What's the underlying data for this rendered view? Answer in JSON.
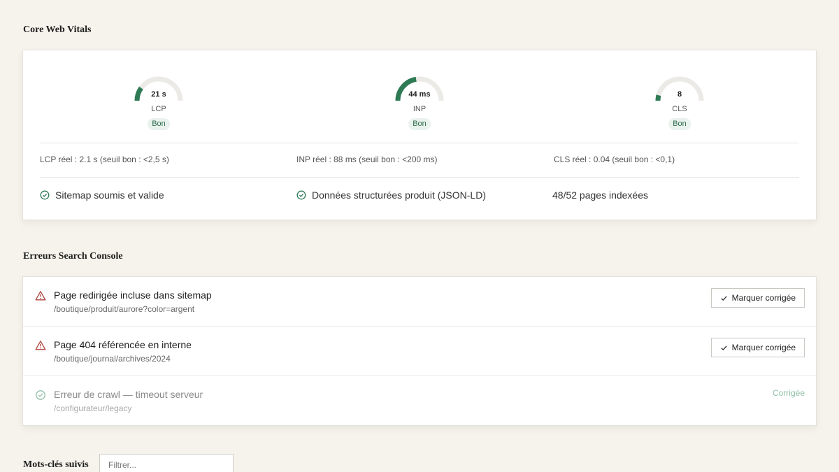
{
  "vitals": {
    "title": "Core Web Vitals",
    "gauges": [
      {
        "value": "21 s",
        "label": "LCP",
        "badge": "Bon",
        "level": 0.2
      },
      {
        "value": "44 ms",
        "label": "INP",
        "badge": "Bon",
        "level": 0.45
      },
      {
        "value": "8",
        "label": "CLS",
        "badge": "Bon",
        "level": 0.08
      }
    ],
    "real": [
      "LCP réel : 2.1 s (seuil bon : <2,5 s)",
      "INP réel : 88 ms (seuil bon : <200 ms)",
      "CLS réel : 0.04 (seuil bon : <0,1)"
    ],
    "status": {
      "sitemap": "Sitemap soumis et valide",
      "structured": "Données structurées produit (JSON-LD)",
      "indexed": "48/52 pages indexées"
    }
  },
  "errors": {
    "title": "Erreurs Search Console",
    "items": [
      {
        "title": "Page redirigée incluse dans sitemap",
        "path": "/boutique/produit/aurore?color=argent",
        "action": "Marquer corrigée"
      },
      {
        "title": "Page 404 référencée en interne",
        "path": "/boutique/journal/archives/2024",
        "action": "Marquer corrigée"
      },
      {
        "title": "Erreur de crawl — timeout serveur",
        "path": "/configurateur/legacy",
        "status": "Corrigée"
      }
    ]
  },
  "keywords": {
    "title": "Mots-clés suivis",
    "filter_placeholder": "Filtrer..."
  },
  "colors": {
    "good": "#2e7a55",
    "warning": "#b0433a",
    "track": "#ebeae6"
  }
}
